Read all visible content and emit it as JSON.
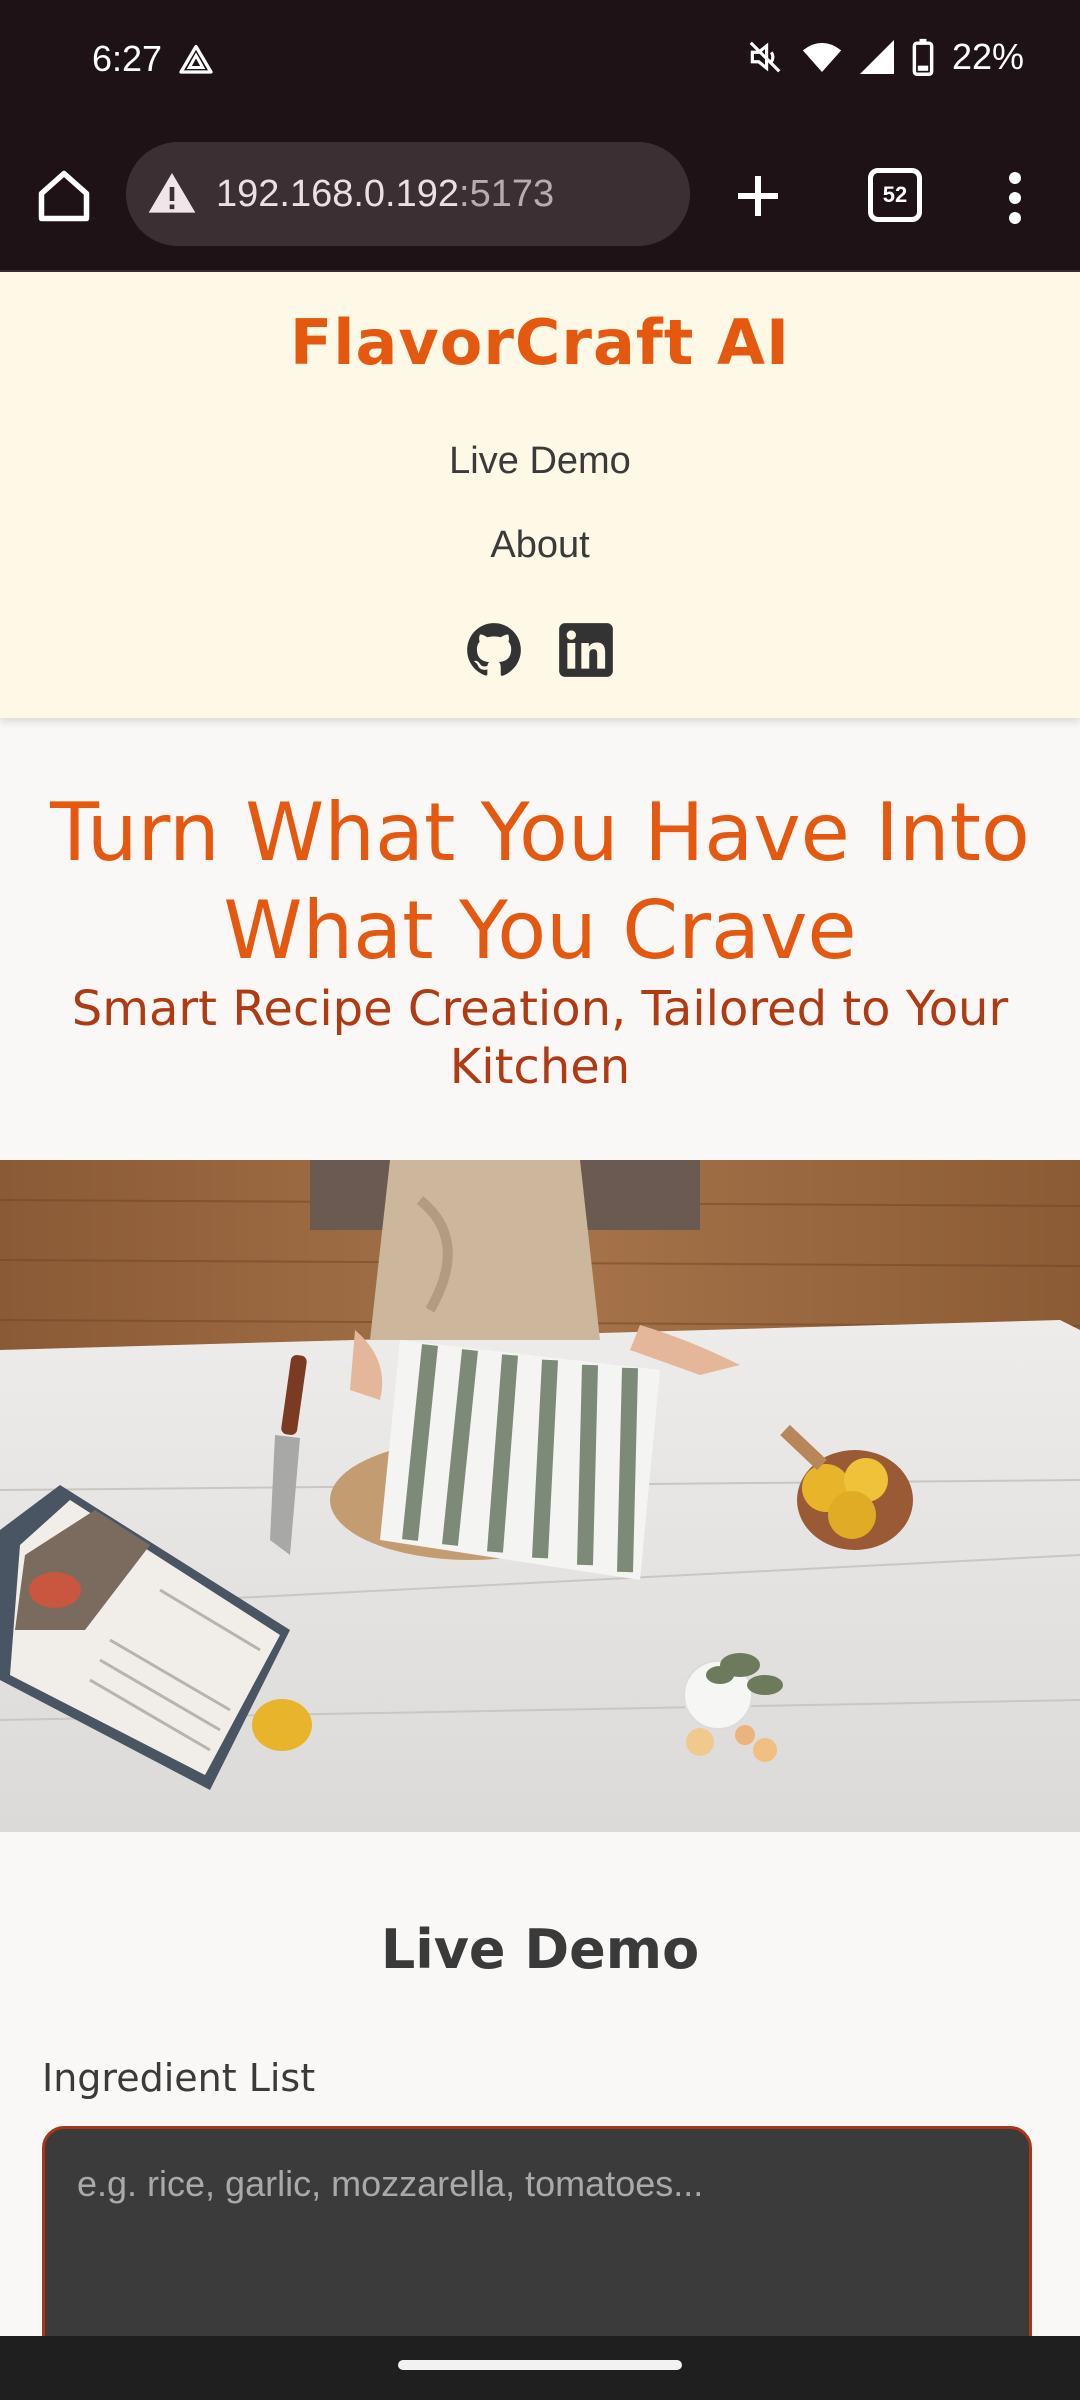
{
  "status_bar": {
    "time": "6:27",
    "battery": "22%",
    "icons": [
      "drive-icon",
      "mute-icon",
      "wifi-icon",
      "signal-icon",
      "battery-icon"
    ]
  },
  "browser": {
    "url_host": "192.168.0.192",
    "url_port": ":5173",
    "tab_count": "52",
    "icons": [
      "home-icon",
      "warning-icon",
      "plus-icon",
      "tabs-icon",
      "menu-icon"
    ]
  },
  "site": {
    "brand": "FlavorCraft AI",
    "nav": {
      "live_demo": "Live Demo",
      "about": "About"
    },
    "social": [
      "github-icon",
      "linkedin-icon"
    ]
  },
  "hero": {
    "title": "Turn What You Have Into What You Crave",
    "subtitle": "Smart Recipe Creation, Tailored to Your Kitchen"
  },
  "demo": {
    "title": "Live Demo",
    "ingredient_label": "Ingredient List",
    "ingredient_placeholder": "e.g. rice, garlic, mozzarella, tomatoes..."
  },
  "colors": {
    "accent": "#e4590f",
    "subtitle": "#b03a12",
    "header_bg": "#fdf9e6",
    "browser_bg": "#1e1217"
  }
}
